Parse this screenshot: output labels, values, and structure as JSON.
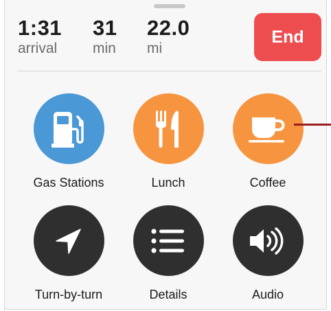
{
  "stats": [
    {
      "value": "1:31",
      "unit": "arrival"
    },
    {
      "value": "31",
      "unit": "min"
    },
    {
      "value": "22.0",
      "unit": "mi"
    }
  ],
  "end_button": {
    "label": "End"
  },
  "options": [
    {
      "label": "Gas Stations",
      "icon": "gas-pump-icon",
      "color": "#4a98d6"
    },
    {
      "label": "Lunch",
      "icon": "fork-knife-icon",
      "color": "#f7943f"
    },
    {
      "label": "Coffee",
      "icon": "coffee-cup-icon",
      "color": "#f7943f"
    },
    {
      "label": "Turn-by-turn",
      "icon": "navigation-arrow-icon",
      "color": "#2f2f2f"
    },
    {
      "label": "Details",
      "icon": "list-icon",
      "color": "#2f2f2f"
    },
    {
      "label": "Audio",
      "icon": "speaker-icon",
      "color": "#2f2f2f"
    }
  ],
  "colors": {
    "end": "#ee4d50",
    "callout_line": "#9b1c22"
  }
}
